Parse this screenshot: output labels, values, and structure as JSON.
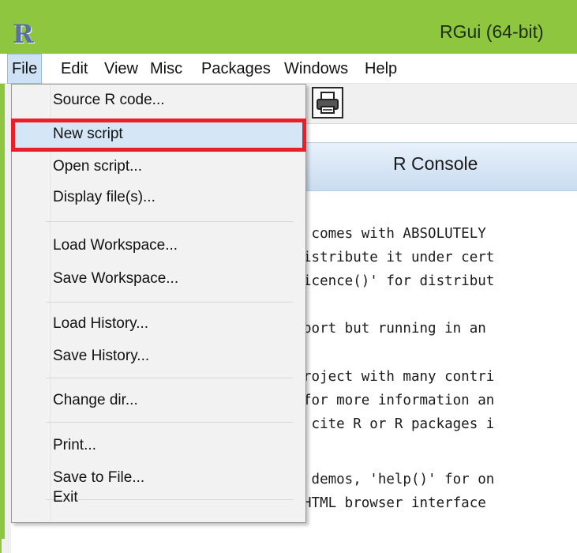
{
  "window": {
    "title": "RGui (64-bit)",
    "logo_text": "R",
    "accent": "#8ec63f"
  },
  "menubar": {
    "items": [
      {
        "label": "File"
      },
      {
        "label": "Edit"
      },
      {
        "label": "View"
      },
      {
        "label": "Misc"
      },
      {
        "label": "Packages"
      },
      {
        "label": "Windows"
      },
      {
        "label": "Help"
      }
    ],
    "active": "File"
  },
  "toolbar": {
    "print_icon": "printer-icon"
  },
  "file_menu": {
    "items": [
      {
        "label": "Source R code..."
      },
      {
        "label": "New script"
      },
      {
        "label": "Open script..."
      },
      {
        "label": "Display file(s)..."
      },
      {
        "label": "Load Workspace..."
      },
      {
        "label": "Save Workspace..."
      },
      {
        "label": "Load History..."
      },
      {
        "label": "Save History..."
      },
      {
        "label": "Change dir..."
      },
      {
        "label": "Print..."
      },
      {
        "label": "Save to File..."
      },
      {
        "label": "Exit"
      }
    ],
    "highlighted": "New script",
    "highlight_color": "#e8202a"
  },
  "console": {
    "title": "R Console",
    "lines": [
      " comes with ABSOLUTELY",
      "istribute it under cert",
      "icence()' for distribut",
      "port but running in an",
      "roject with many contri",
      "for more information an",
      " cite R or R packages i",
      " demos, 'help()' for on",
      "HTML browser interface"
    ]
  }
}
